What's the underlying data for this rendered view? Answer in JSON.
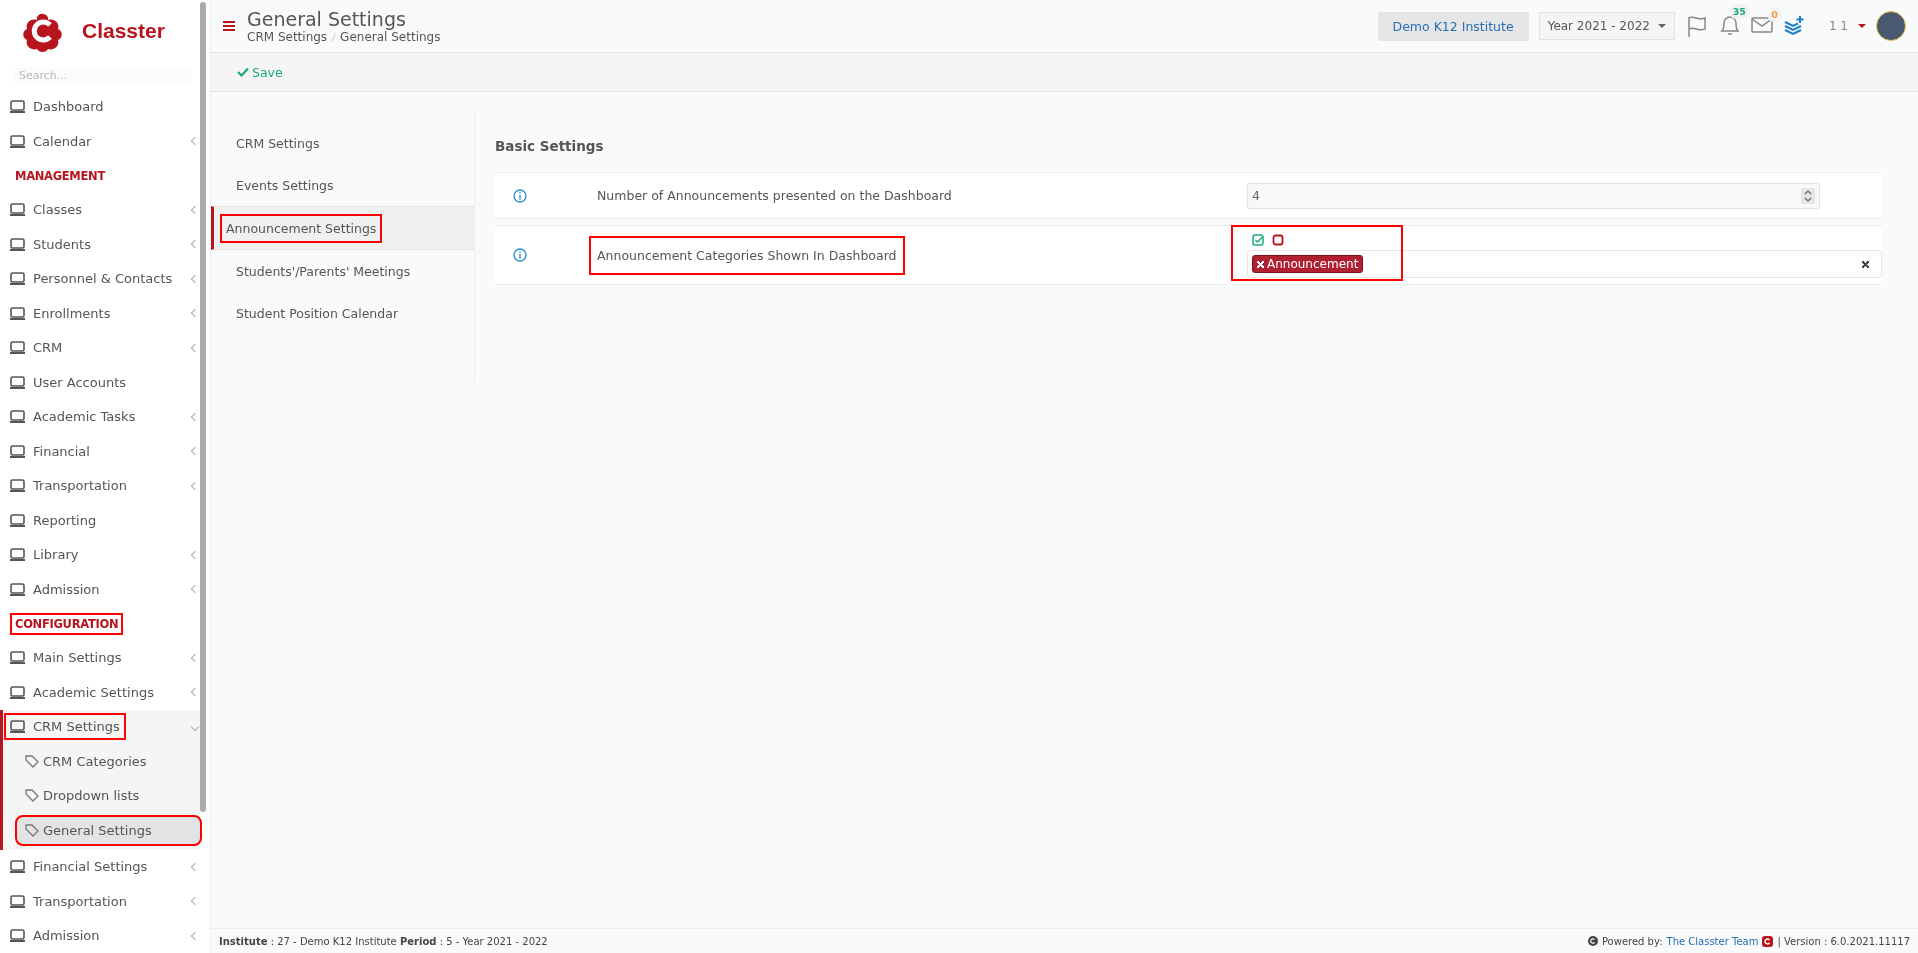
{
  "sidebar": {
    "logo": "Classter",
    "search": {
      "placeholder": "Search..."
    },
    "items": [
      {
        "kind": "link",
        "label": "Dashboard",
        "submenu": false,
        "highlighted": false
      },
      {
        "kind": "link",
        "label": "Calendar",
        "submenu": true,
        "highlighted": false
      },
      {
        "kind": "header",
        "label": "MANAGEMENT",
        "highlighted": false
      },
      {
        "kind": "link",
        "label": "Classes",
        "submenu": true,
        "highlighted": false
      },
      {
        "kind": "link",
        "label": "Students",
        "submenu": true,
        "highlighted": false
      },
      {
        "kind": "link",
        "label": "Personnel & Contacts",
        "submenu": true,
        "highlighted": false
      },
      {
        "kind": "link",
        "label": "Enrollments",
        "submenu": true,
        "highlighted": false
      },
      {
        "kind": "link",
        "label": "CRM",
        "submenu": true,
        "highlighted": false
      },
      {
        "kind": "link",
        "label": "User Accounts",
        "submenu": false,
        "highlighted": false
      },
      {
        "kind": "link",
        "label": "Academic Tasks",
        "submenu": true,
        "highlighted": false
      },
      {
        "kind": "link",
        "label": "Financial",
        "submenu": true,
        "highlighted": false
      },
      {
        "kind": "link",
        "label": "Transportation",
        "submenu": true,
        "highlighted": false
      },
      {
        "kind": "link",
        "label": "Reporting",
        "submenu": false,
        "highlighted": false
      },
      {
        "kind": "link",
        "label": "Library",
        "submenu": true,
        "highlighted": false
      },
      {
        "kind": "link",
        "label": "Admission",
        "submenu": true,
        "highlighted": false
      },
      {
        "kind": "header",
        "label": "CONFIGURATION",
        "highlighted": true
      },
      {
        "kind": "link",
        "label": "Main Settings",
        "submenu": true,
        "highlighted": false
      },
      {
        "kind": "link",
        "label": "Academic Settings",
        "submenu": true,
        "highlighted": false
      },
      {
        "kind": "link",
        "label": "CRM Settings",
        "submenu": true,
        "expanded": true,
        "highlighted": true,
        "children": [
          {
            "label": "CRM Categories",
            "selected": false,
            "highlighted": false
          },
          {
            "label": "Dropdown lists",
            "selected": false,
            "highlighted": false
          },
          {
            "label": "General Settings",
            "selected": true,
            "highlighted": true
          }
        ]
      },
      {
        "kind": "link",
        "label": "Financial Settings",
        "submenu": true,
        "highlighted": false
      },
      {
        "kind": "link",
        "label": "Transportation",
        "submenu": true,
        "highlighted": false
      },
      {
        "kind": "link",
        "label": "Admission",
        "submenu": true,
        "highlighted": false
      }
    ]
  },
  "header": {
    "title": "General Settings",
    "breadcrumb": [
      "CRM Settings",
      "General Settings"
    ],
    "institute": "Demo K12 Institute",
    "year": "Year 2021 - 2022",
    "notifications": "35",
    "messages": "0",
    "user": "1 1"
  },
  "toolbar": {
    "save": "Save"
  },
  "settings_nav": [
    {
      "label": "CRM Settings",
      "selected": false,
      "highlighted": false
    },
    {
      "label": "Events Settings",
      "selected": false,
      "highlighted": false
    },
    {
      "label": "Announcement Settings",
      "selected": true,
      "highlighted": true
    },
    {
      "label": "Students'/Parents' Meetings",
      "selected": false,
      "highlighted": false
    },
    {
      "label": "Student Position Calendar",
      "selected": false,
      "highlighted": false
    }
  ],
  "section_title": "Basic Settings",
  "settings": [
    {
      "kind": "number",
      "label": "Number of Announcements presented on the Dashboard",
      "value": "4",
      "label_highlighted": false,
      "control_highlighted": false
    },
    {
      "kind": "tags",
      "label": "Announcement Categories Shown In Dashboard",
      "tags": [
        "Announcement"
      ],
      "label_highlighted": true,
      "control_highlighted": true
    }
  ],
  "footer": {
    "info": "**Institute** : 27 - Demo K12 Institute **Period** : 5 - Year 2021 - 2022",
    "powered": "Powered by:",
    "team": "The Classter Team",
    "version": "| Version : 6.0.2021.11117"
  }
}
